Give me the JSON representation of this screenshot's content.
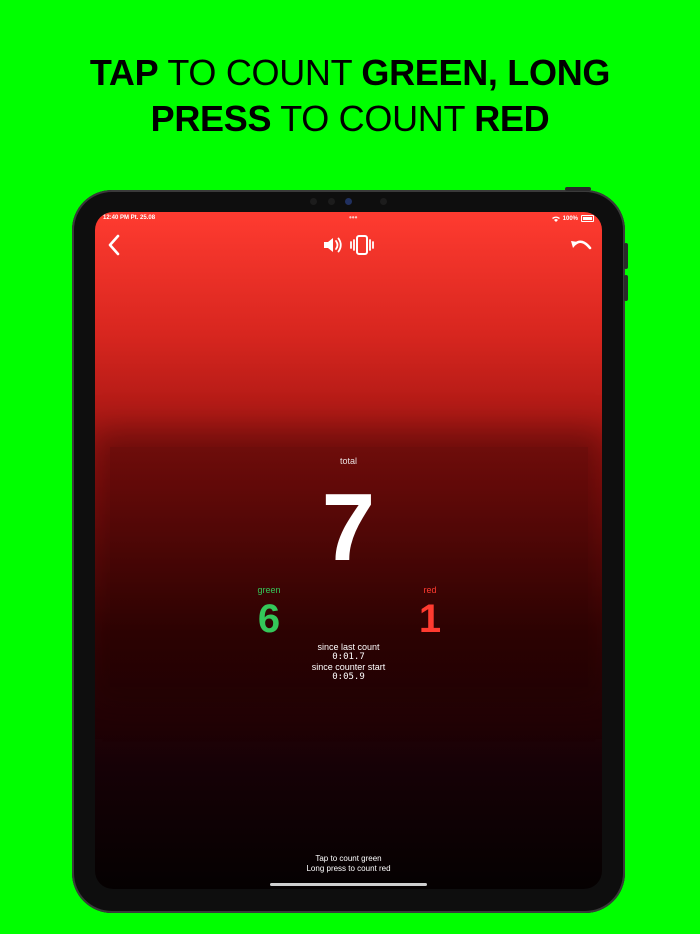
{
  "headline": {
    "line1": [
      {
        "text": "TAP",
        "bold": true
      },
      {
        "text": " TO COUNT ",
        "bold": false
      },
      {
        "text": "GREEN, LONG",
        "bold": true
      }
    ],
    "line2": [
      {
        "text": "PRESS",
        "bold": true
      },
      {
        "text": " TO COUNT ",
        "bold": false
      },
      {
        "text": "RED",
        "bold": true
      }
    ]
  },
  "status_bar": {
    "time": "12:40 PM   Pt. 25.08",
    "dots": "•••",
    "battery": "100%"
  },
  "toolbar": {
    "back_icon": "chevron-left-icon",
    "sound_icon": "speaker-icon",
    "vibration_icon": "vibration-icon",
    "undo_icon": "undo-icon"
  },
  "counter": {
    "total_label": "total",
    "total_value": "7",
    "green_label": "green",
    "green_value": "6",
    "red_label": "red",
    "red_value": "1",
    "since_last_label": "since last count",
    "since_last_value": "0:01.7",
    "since_start_label": "since counter start",
    "since_start_value": "0:05.9"
  },
  "hint": {
    "line1": "Tap to count green",
    "line2": "Long press to count red"
  },
  "colors": {
    "background": "#00ff00",
    "green": "#34c759",
    "red": "#ff3b30"
  }
}
